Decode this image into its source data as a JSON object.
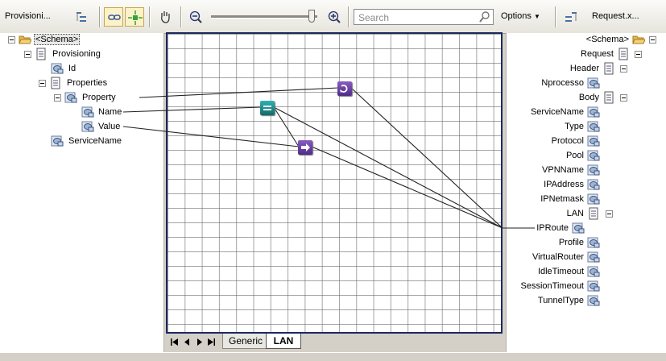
{
  "toolbar": {
    "source_label": "Provisioni...",
    "target_label": "Request.x...",
    "search_placeholder": "Search",
    "options_label": "Options",
    "zoom_level": 0.95
  },
  "source_tree": {
    "root": "<Schema>",
    "provisioning": "Provisioning",
    "id": "Id",
    "properties": "Properties",
    "property": "Property",
    "name": "Name",
    "value": "Value",
    "service_name": "ServiceName"
  },
  "target_tree": {
    "root": "<Schema>",
    "request": "Request",
    "header": "Header",
    "nprocesso": "Nprocesso",
    "body": "Body",
    "fields": [
      "ServiceName",
      "Type",
      "Protocol",
      "Pool",
      "VPNName",
      "IPAddress",
      "IPNetmask"
    ],
    "lan": "LAN",
    "lan_fields": [
      "IPRoute",
      "Profile",
      "VirtualRouter",
      "IdleTimeout",
      "SessionTimeout",
      "TunnelType"
    ]
  },
  "tabs": {
    "generic": "Generic",
    "lan": "LAN"
  },
  "colors": {
    "canvas_border": "#1b2960",
    "function_purple": "#6b3fa0",
    "function_teal": "#1a8a8a"
  }
}
